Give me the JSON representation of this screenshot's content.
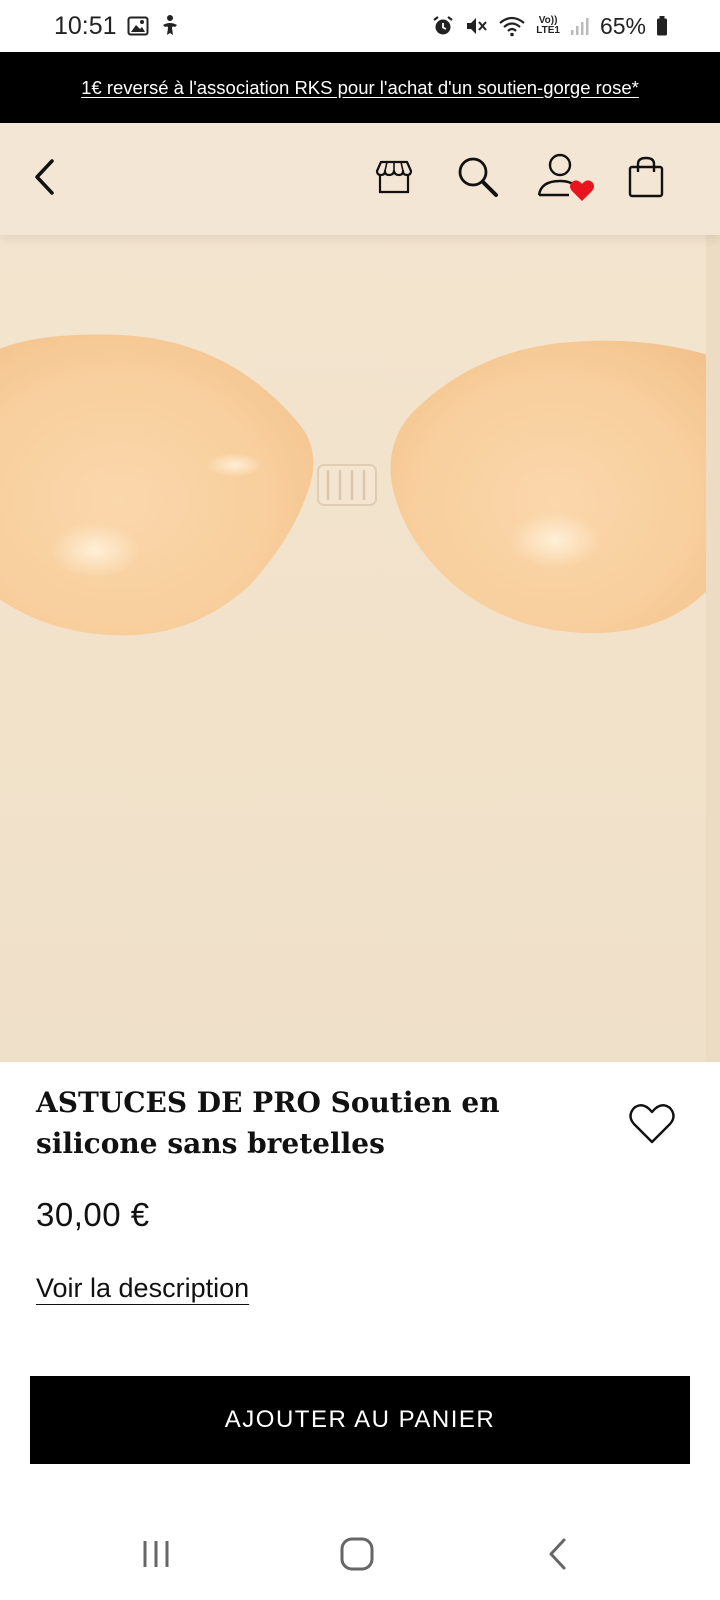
{
  "status_bar": {
    "time": "10:51",
    "battery_percent": "65%",
    "left_icons": [
      "gallery-icon",
      "accessibility-icon"
    ],
    "right_icons": [
      "alarm-icon",
      "mute-icon",
      "wifi-icon",
      "volte-icon",
      "signal-icon",
      "battery-icon"
    ],
    "volte_top": "Vo))",
    "volte_bottom": "LTE1"
  },
  "promo": {
    "text": "1€ reversé à l'association RKS pour l'achat d'un soutien-gorge rose*"
  },
  "header": {
    "icons": [
      "back-icon",
      "store-icon",
      "search-icon",
      "account-icon",
      "wishlist-heart-icon",
      "bag-icon"
    ],
    "background": "#f4e6d4",
    "heart_color": "#e8141e"
  },
  "product": {
    "title": "ASTUCES DE PRO Soutien en silicone sans bretelles",
    "price": "30,00 €",
    "description_link": "Voir la description",
    "add_to_cart": "AJOUTER AU PANIER",
    "image_background": "#f2e2ca",
    "image_color": "#f7cf9f"
  },
  "nav": {
    "icons": [
      "recents-icon",
      "home-icon",
      "back-nav-icon"
    ]
  }
}
